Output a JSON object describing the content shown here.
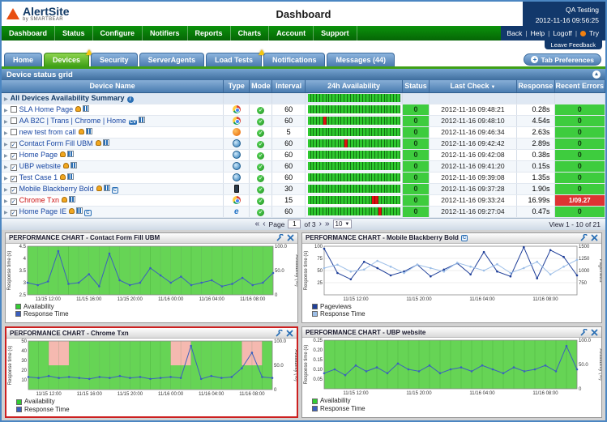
{
  "header": {
    "logo": "AlertSite",
    "logo_sub": "by SMARTBEAR",
    "title": "Dashboard",
    "account": "QA Testing",
    "datetime": "2012-11-16 09:56:25"
  },
  "nav": {
    "items": [
      "Dashboard",
      "Status",
      "Configure",
      "Notifiers",
      "Reports",
      "Charts",
      "Account",
      "Support"
    ],
    "right_links": [
      "Back",
      "Help",
      "Logoff"
    ],
    "try_label": "Try",
    "feedback": "Leave Feedback"
  },
  "tabs": {
    "items": [
      {
        "label": "Home",
        "active": false,
        "warning": false
      },
      {
        "label": "Devices",
        "active": true,
        "warning": true
      },
      {
        "label": "Security",
        "active": false,
        "warning": false
      },
      {
        "label": "ServerAgents",
        "active": false,
        "warning": false
      },
      {
        "label": "Load Tests",
        "active": false,
        "warning": true
      },
      {
        "label": "Notifications",
        "active": false,
        "warning": false
      },
      {
        "label": "Messages (44)",
        "active": false,
        "warning": false
      }
    ],
    "preferences_label": "Tab Preferences"
  },
  "grid": {
    "title": "Device status grid",
    "columns": [
      "Device Name",
      "Type",
      "Mode",
      "Interval",
      "24h Availability",
      "Status",
      "Last Check",
      "Response",
      "Recent Errors"
    ],
    "summary": {
      "label": "All Devices Availability Summary",
      "avail": "gggggggggggggggggggggggggggggg"
    },
    "rows": [
      {
        "name": "SLA Home Page",
        "checked": false,
        "alert": false,
        "badges": [
          "bell",
          "chart"
        ],
        "type": "chrome",
        "interval": "60",
        "avail": "gggggggggggggggggggggggggggggg",
        "status": "0",
        "last_check": "2012-11-16 09:48:21",
        "response": "0.28s",
        "errors": "0",
        "errors_alert": false
      },
      {
        "name": "AA B2C | Trans | Chrome | Home",
        "checked": false,
        "alert": false,
        "badges": [
          "cv",
          "chart"
        ],
        "type": "chrome",
        "interval": "60",
        "avail": "gggggrgggggggggggggggggggggggg",
        "status": "0",
        "last_check": "2012-11-16 09:48:10",
        "response": "4.54s",
        "errors": "0",
        "errors_alert": false
      },
      {
        "name": "new test from call",
        "checked": false,
        "alert": false,
        "badges": [
          "bell",
          "chart"
        ],
        "type": "firefox",
        "interval": "5",
        "avail": "gggggggggggggggggggggggggggggg",
        "status": "0",
        "last_check": "2012-11-16 09:46:34",
        "response": "2.63s",
        "errors": "0",
        "errors_alert": false
      },
      {
        "name": "Contact Form Fill UBM",
        "checked": true,
        "alert": false,
        "badges": [
          "bell",
          "chart"
        ],
        "type": "globe",
        "interval": "60",
        "avail": "ggggggggggggrggggggggggggggggg",
        "status": "0",
        "last_check": "2012-11-16 09:42:42",
        "response": "2.89s",
        "errors": "0",
        "errors_alert": false
      },
      {
        "name": "Home Page",
        "checked": true,
        "alert": false,
        "badges": [
          "bell",
          "chart"
        ],
        "type": "globe",
        "interval": "60",
        "avail": "gggggggggggggggggggggggggggggg",
        "status": "0",
        "last_check": "2012-11-16 09:42:08",
        "response": "0.38s",
        "errors": "0",
        "errors_alert": false
      },
      {
        "name": "UBP website",
        "checked": true,
        "alert": false,
        "badges": [
          "bell",
          "chart"
        ],
        "type": "globe",
        "interval": "60",
        "avail": "gggggggggggggggggggggggggggggg",
        "status": "0",
        "last_check": "2012-11-16 09:41:20",
        "response": "0.15s",
        "errors": "0",
        "errors_alert": false
      },
      {
        "name": "Test Case 1",
        "checked": true,
        "alert": false,
        "badges": [
          "bell",
          "chart"
        ],
        "type": "globe",
        "interval": "60",
        "avail": "gggggggggggggggggggggggggggggg",
        "status": "0",
        "last_check": "2012-11-16 09:39:08",
        "response": "1.35s",
        "errors": "0",
        "errors_alert": false
      },
      {
        "name": "Mobile Blackberry Bold",
        "checked": true,
        "alert": false,
        "badges": [
          "bell",
          "chart",
          "c"
        ],
        "type": "mobile",
        "interval": "30",
        "avail": "gggggggggggggggggggggggggggggg",
        "status": "0",
        "last_check": "2012-11-16 09:37:28",
        "response": "1.90s",
        "errors": "0",
        "errors_alert": false
      },
      {
        "name": "Chrome Txn",
        "checked": true,
        "alert": true,
        "badges": [
          "bell",
          "chart"
        ],
        "type": "chrome",
        "interval": "15",
        "avail": "gggggggggggggggggggggrrggggggg",
        "status": "0",
        "last_check": "2012-11-16 09:33:24",
        "response": "16.99s",
        "errors": "1/09.27",
        "errors_alert": true
      },
      {
        "name": "Home Page IE",
        "checked": true,
        "alert": false,
        "badges": [
          "bell",
          "chart",
          "c"
        ],
        "type": "ie",
        "interval": "60",
        "avail": "gggggggggggggggggggggggrgggggg",
        "status": "0",
        "last_check": "2012-11-16 09:27:04",
        "response": "0.47s",
        "errors": "0",
        "errors_alert": false
      }
    ]
  },
  "pagination": {
    "page_label": "Page",
    "current": "1",
    "of_label": "of 3",
    "per_page": "10",
    "view_label": "View 1 - 10 of 21"
  },
  "colors": {
    "status_ok": "#3ecc3e",
    "status_error": "#dd3333",
    "availability_green": "#66d455",
    "availability_pink": "#f5b9b0",
    "nav_green": "#0c930c",
    "accent_blue": "#4a7cb0"
  },
  "charts": [
    {
      "title": "PERFORMANCE CHART - Contact Form Fill UBM",
      "left_label": "Response time (s)",
      "right_label": "Availability (%)",
      "ylim": [
        2.5,
        4.5
      ],
      "yticks": [
        "2.5",
        "3",
        "3.5",
        "4",
        "4.5"
      ],
      "right_lim": [
        0,
        100
      ],
      "right_ticks": [
        "0",
        "50.0",
        "100.0"
      ],
      "xlabels": [
        "11/15 12:00",
        "11/15 16:00",
        "11/15 20:00",
        "11/16 00:00",
        "11/16 04:00",
        "11/16 08:00"
      ],
      "availability": [
        100,
        100,
        100,
        100,
        100,
        100,
        100,
        100,
        100,
        100,
        100,
        100,
        100,
        100,
        100,
        100,
        100,
        100,
        100,
        100,
        100,
        100,
        100,
        100,
        100
      ],
      "lines": [
        {
          "name": "Response Time",
          "color": "#3a5fbf",
          "axis": "left",
          "values": [
            3.0,
            2.9,
            3.05,
            4.3,
            2.95,
            3.0,
            3.35,
            2.85,
            4.2,
            3.1,
            2.9,
            3.0,
            3.6,
            3.3,
            3.0,
            3.25,
            2.9,
            3.0,
            3.1,
            2.85,
            2.95,
            3.2,
            2.9,
            3.0,
            3.4
          ]
        }
      ],
      "legend": [
        {
          "label": "Availability",
          "color": "#33cc33"
        },
        {
          "label": "Response Time",
          "color": "#3a5fbf"
        }
      ]
    },
    {
      "title": "PERFORMANCE CHART - Mobile Blackberry Bold",
      "title_badge": "C",
      "left_label": "Response time (s)",
      "right_label": "Pageviews",
      "ylim": [
        0,
        100
      ],
      "yticks": [
        "25",
        "50",
        "75",
        "100"
      ],
      "right_lim": [
        500,
        1500
      ],
      "right_ticks": [
        "750",
        "1000",
        "1250",
        "1500"
      ],
      "xlabels": [
        "11/15 12:00",
        "11/15 20:00",
        "11/16 04:00",
        "11/16 08:00"
      ],
      "lines": [
        {
          "name": "Pageviews",
          "color": "#1f3f99",
          "axis": "right",
          "values": [
            1450,
            950,
            820,
            1180,
            1050,
            900,
            980,
            1120,
            880,
            1020,
            1150,
            920,
            1380,
            980,
            880,
            1480,
            840,
            1420,
            1280,
            900
          ]
        },
        {
          "name": "Response Time",
          "color": "#9dbfe8",
          "axis": "left",
          "values": [
            55,
            62,
            48,
            52,
            70,
            58,
            45,
            62,
            55,
            48,
            66,
            58,
            50,
            63,
            45,
            55,
            68,
            42,
            58,
            72
          ]
        }
      ],
      "legend": [
        {
          "label": "Pageviews",
          "color": "#1f3f99"
        },
        {
          "label": "Response Time",
          "color": "#9dbfe8"
        }
      ]
    },
    {
      "title": "PERFORMANCE CHART - Chrome Txn",
      "alert": true,
      "left_label": "Response time (s)",
      "right_label": "Availability (%)",
      "ylim": [
        0,
        50
      ],
      "yticks": [
        "10",
        "20",
        "30",
        "40",
        "50"
      ],
      "right_lim": [
        0,
        100
      ],
      "right_ticks": [
        "0",
        "50.0",
        "100.0"
      ],
      "xlabels": [
        "11/15 12:00",
        "11/15 16:00",
        "11/15 20:00",
        "11/16 00:00",
        "11/16 04:00",
        "11/16 08:00"
      ],
      "availability": [
        100,
        100,
        50,
        50,
        100,
        100,
        100,
        100,
        100,
        100,
        100,
        100,
        100,
        100,
        50,
        50,
        100,
        100,
        100,
        100,
        100,
        50,
        50,
        100,
        100
      ],
      "lines": [
        {
          "name": "Response Time",
          "color": "#3a5fbf",
          "axis": "left",
          "values": [
            13,
            12,
            14,
            12,
            13,
            12,
            11,
            13,
            12,
            14,
            12,
            13,
            11,
            12,
            13,
            12,
            45,
            11,
            14,
            12,
            13,
            22,
            38,
            13,
            12
          ]
        }
      ],
      "legend": [
        {
          "label": "Availability",
          "color": "#33cc33"
        },
        {
          "label": "Response Time",
          "color": "#3a5fbf"
        }
      ]
    },
    {
      "title": "PERFORMANCE CHART - UBP website",
      "left_label": "Response time (s)",
      "right_label": "Availability (%)",
      "ylim": [
        0,
        0.25
      ],
      "yticks": [
        "0.05",
        "0.10",
        "0.15",
        "0.20",
        "0.25"
      ],
      "right_lim": [
        0,
        100
      ],
      "right_ticks": [
        "0",
        "50.0",
        "100.0"
      ],
      "xlabels": [
        "11/15 12:00",
        "11/15 20:00",
        "11/16 04:00",
        "11/16 08:00"
      ],
      "availability": [
        100,
        100,
        100,
        100,
        100,
        100,
        100,
        100,
        100,
        100,
        100,
        100,
        100,
        100,
        100,
        100,
        100,
        100,
        100,
        100,
        100,
        100,
        100,
        100,
        100
      ],
      "lines": [
        {
          "name": "Response Time",
          "color": "#3a5fbf",
          "axis": "left",
          "values": [
            0.08,
            0.1,
            0.07,
            0.12,
            0.09,
            0.11,
            0.08,
            0.13,
            0.1,
            0.09,
            0.12,
            0.08,
            0.1,
            0.11,
            0.09,
            0.12,
            0.1,
            0.08,
            0.11,
            0.09,
            0.1,
            0.12,
            0.09,
            0.22,
            0.1
          ]
        }
      ],
      "legend": [
        {
          "label": "Availability",
          "color": "#33cc33"
        },
        {
          "label": "Response Time",
          "color": "#3a5fbf"
        }
      ]
    }
  ]
}
